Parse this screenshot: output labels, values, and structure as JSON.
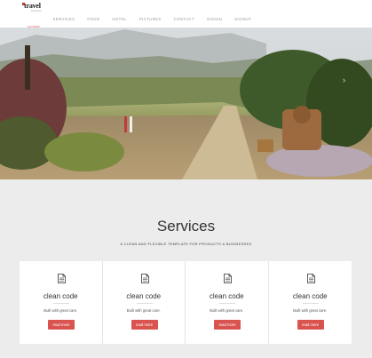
{
  "brand": {
    "logo_main": "travel",
    "logo_sub": "tourism"
  },
  "nav": {
    "items": [
      {
        "label": "HOME",
        "active": true
      },
      {
        "label": "SERVICES",
        "active": false
      },
      {
        "label": "FOOD",
        "active": false
      },
      {
        "label": "HOTEL",
        "active": false
      },
      {
        "label": "PICTURES",
        "active": false
      },
      {
        "label": "CONTACT",
        "active": false
      },
      {
        "label": "SIGNIN",
        "active": false
      },
      {
        "label": "SIGNUP",
        "active": false
      }
    ]
  },
  "hero": {
    "next_arrow": "›"
  },
  "services": {
    "title": "Services",
    "subtitle": "A CLEAN AND FLEXIBLE TEMPLATE FOR PRODUCTS & BUSINESSES",
    "cards": [
      {
        "icon": "document-icon",
        "title": "clean code",
        "text": "Built with great care.",
        "button": "read more"
      },
      {
        "icon": "document-icon",
        "title": "clean code",
        "text": "Built with great care.",
        "button": "read more"
      },
      {
        "icon": "document-icon",
        "title": "clean code",
        "text": "Built with great care.",
        "button": "read more"
      },
      {
        "icon": "document-icon",
        "title": "clean code",
        "text": "Built with great care.",
        "button": "read more"
      }
    ]
  },
  "colors": {
    "accent": "#d9534f",
    "background": "#ececec",
    "card": "#ffffff"
  }
}
